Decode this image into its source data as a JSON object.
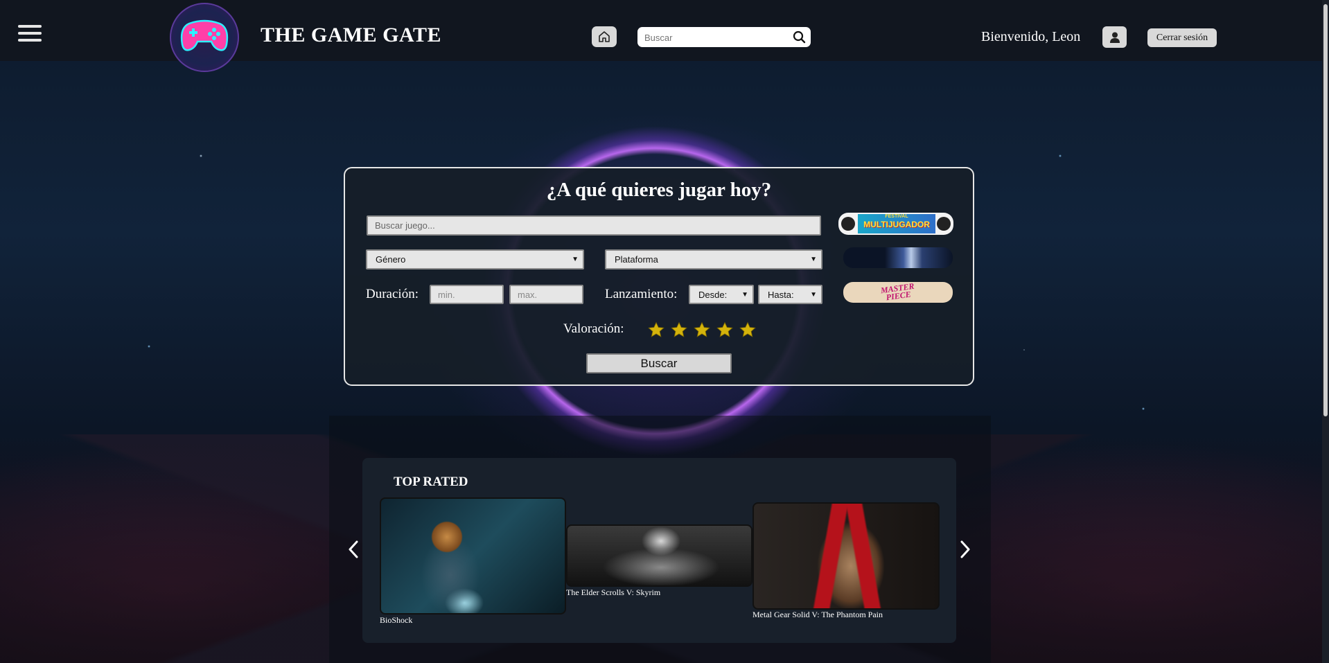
{
  "header": {
    "site_title": "THE GAME GATE",
    "search_placeholder": "Buscar",
    "welcome": "Bienvenido, Leon",
    "logout_label": "Cerrar sesión"
  },
  "search_panel": {
    "title": "¿A qué quieres jugar hoy?",
    "game_input_placeholder": "Buscar juego...",
    "genre_select": "Género",
    "platform_select": "Plataforma",
    "duration_label": "Duración:",
    "duration_min_placeholder": "min.",
    "duration_max_placeholder": "max.",
    "release_label": "Lanzamiento:",
    "release_from": "Desde:",
    "release_to": "Hasta:",
    "rating_label": "Valoración:",
    "rating_stars": 5,
    "search_button": "Buscar",
    "banners": {
      "multiplayer_line1": "FESTIVAL",
      "multiplayer_line2": "MULTIJUGADOR",
      "masterpiece_line1": "MASTER",
      "masterpiece_line2": "PIECE"
    }
  },
  "top_rated": {
    "title": "TOP RATED",
    "games": [
      {
        "title": "BioShock"
      },
      {
        "title": "The Elder Scrolls V: Skyrim"
      },
      {
        "title": "Metal Gear Solid V: The Phantom Pain"
      }
    ]
  },
  "colors": {
    "star": "#d4b30c",
    "accent_glow": "#c86eff"
  }
}
